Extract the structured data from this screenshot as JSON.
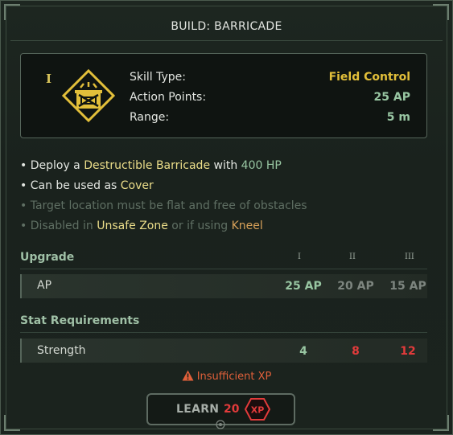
{
  "title": "BUILD: BARRICADE",
  "skill": {
    "rank": "I",
    "icon": "barricade-icon",
    "stats": [
      {
        "label": "Skill Type:",
        "value": "Field Control",
        "color": "#e2bf3a"
      },
      {
        "label": "Action Points:",
        "value": "25 AP",
        "color": "#98c6a2"
      },
      {
        "label": "Range:",
        "value": "5 m",
        "color": "#98c6a2"
      }
    ]
  },
  "bullets": {
    "b1": {
      "pre": "• Deploy a ",
      "hl1": "Destructible Barricade",
      "mid": " with ",
      "hl2": "400 HP"
    },
    "b2": {
      "pre": "• Can be used as ",
      "hl1": "Cover"
    },
    "b3": {
      "text": "• Target location must be flat and free of obstacles"
    },
    "b4": {
      "pre": "• Disabled in ",
      "hl1": "Unsafe Zone",
      "mid": " or if using ",
      "hl2": "Kneel"
    }
  },
  "upgrade": {
    "heading": "Upgrade",
    "levels": [
      "I",
      "II",
      "III"
    ],
    "row_label": "AP",
    "values": [
      "25 AP",
      "20 AP",
      "15 AP"
    ]
  },
  "requirements": {
    "heading": "Stat Requirements",
    "row_label": "Strength",
    "values": [
      "4",
      "8",
      "12"
    ]
  },
  "warning": "Insufficient XP",
  "learn": {
    "label": "LEARN",
    "cost": "20",
    "xp_badge": "XP"
  },
  "colors": {
    "accent_gold": "#e2bf3a",
    "accent_green": "#98c6a2",
    "warning_red": "#e23b3b"
  }
}
